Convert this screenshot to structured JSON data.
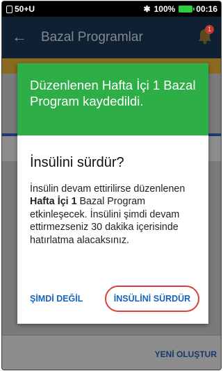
{
  "status_bar": {
    "network": "50+U",
    "battery": "100%",
    "time": "00:16"
  },
  "app_bar": {
    "title": "Bazal Programlar",
    "notification_count": "1"
  },
  "dialog": {
    "header": "Düzenlenen Hafta İçi 1 Bazal Program kaydedildi.",
    "title": "İnsülini sürdür?",
    "body_part1": "İnsülin devam ettirilirse düzenlenen ",
    "body_bold": "Hafta İçi 1",
    "body_part2": " Bazal Program etkinleşecek. İnsülini şimdi devam ettirmezseniz 30 dakika içerisinde hatırlatma alacaksınız.",
    "not_now_label": "ŞİMDİ DEĞİL",
    "resume_label": "İNSÜLİNİ SÜRDÜR"
  },
  "background": {
    "create_label": "YENİ OLUŞTUR"
  },
  "colors": {
    "header_green": "#2eae46",
    "link_blue": "#1565c0",
    "highlight_red": "#d9413a",
    "app_bar_navy": "#102033"
  },
  "icons": {
    "back": "arrow-left-icon",
    "bell": "bell-icon",
    "bluetooth": "bluetooth-icon",
    "battery": "battery-icon",
    "sim": "sim-icon"
  }
}
